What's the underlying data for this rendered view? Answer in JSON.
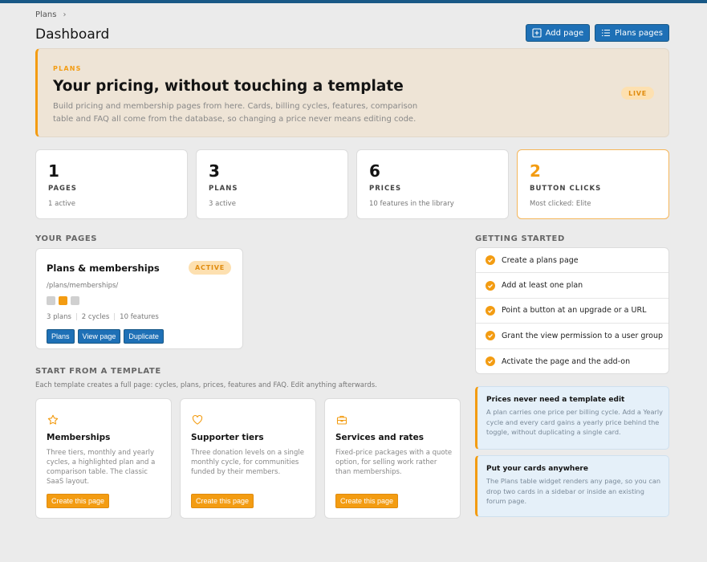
{
  "breadcrumb": {
    "root": "Plans"
  },
  "page_title": "Dashboard",
  "header_actions": {
    "add_page": "Add page",
    "plans_pages": "Plans pages"
  },
  "hero": {
    "eyebrow": "PLANS",
    "title": "Your pricing, without touching a template",
    "desc": "Build pricing and membership pages from here. Cards, billing cycles, features, comparison table and FAQ all come from the database, so changing a price never means editing code.",
    "badge": "LIVE"
  },
  "stats": [
    {
      "num": "1",
      "label": "PAGES",
      "sub": "1 active"
    },
    {
      "num": "3",
      "label": "PLANS",
      "sub": "3 active"
    },
    {
      "num": "6",
      "label": "PRICES",
      "sub": "10 features in the library"
    },
    {
      "num": "2",
      "label": "BUTTON CLICKS",
      "sub": "Most clicked: Elite"
    }
  ],
  "your_pages": {
    "heading": "YOUR PAGES",
    "card": {
      "name": "Plans & memberships",
      "status": "ACTIVE",
      "path": "/plans/memberships/",
      "plans": "3 plans",
      "cycles": "2 cycles",
      "features": "10 features",
      "actions": {
        "plans": "Plans",
        "view": "View page",
        "duplicate": "Duplicate"
      }
    }
  },
  "templates": {
    "heading": "START FROM A TEMPLATE",
    "desc": "Each template creates a full page: cycles, plans, prices, features and FAQ. Edit anything afterwards.",
    "items": [
      {
        "icon": "star-icon",
        "name": "Memberships",
        "desc": "Three tiers, monthly and yearly cycles, a highlighted plan and a comparison table. The classic SaaS layout.",
        "button": "Create this page"
      },
      {
        "icon": "heart-icon",
        "name": "Supporter tiers",
        "desc": "Three donation levels on a single monthly cycle, for communities funded by their members.",
        "button": "Create this page"
      },
      {
        "icon": "briefcase-icon",
        "name": "Services and rates",
        "desc": "Fixed-price packages with a quote option, for selling work rather than memberships.",
        "button": "Create this page"
      }
    ]
  },
  "getting_started": {
    "heading": "GETTING STARTED",
    "items": [
      "Create a plans page",
      "Add at least one plan",
      "Point a button at an upgrade or a URL",
      "Grant the view permission to a user group",
      "Activate the page and the add-on"
    ]
  },
  "tips": [
    {
      "title": "Prices never need a template edit",
      "desc": "A plan carries one price per billing cycle. Add a Yearly cycle and every card gains a yearly price behind the toggle, without duplicating a single card."
    },
    {
      "title": "Put your cards anywhere",
      "desc": "The Plans table widget renders any page, so you can drop two cards in a sidebar or inside an existing forum page."
    }
  ],
  "colors": {
    "accent": "#f39c12",
    "primary": "#1e70b6",
    "topbar": "#185886"
  }
}
